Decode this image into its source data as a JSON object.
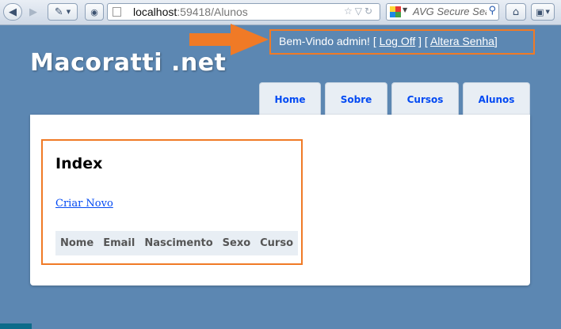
{
  "browser": {
    "url_host": "localhost",
    "url_rest": ":59418/Alunos",
    "search_placeholder": "AVG Secure Sea",
    "icons": [
      "back-arrow-icon",
      "forward-arrow-icon",
      "dropdown-icon",
      "page-icon",
      "star-icon",
      "refresh-icon",
      "search-icon",
      "home-icon",
      "bookmark-icon"
    ]
  },
  "site": {
    "title": "Macoratti .net"
  },
  "login": {
    "welcome": "Bem-Vindo admin!",
    "open_bracket_1": "[",
    "logoff": "Log Off",
    "close_open": "] [",
    "change_password": "Altera Senha",
    "close_bracket": "]"
  },
  "nav": {
    "tabs": [
      {
        "label": "Home"
      },
      {
        "label": "Sobre"
      },
      {
        "label": "Cursos"
      },
      {
        "label": "Alunos"
      }
    ]
  },
  "main": {
    "heading": "Index",
    "create_link": "Criar Novo",
    "columns": [
      "Nome",
      "Email",
      "Nascimento",
      "Sexo",
      "Curso"
    ]
  },
  "colors": {
    "page_bg": "#5c87b2",
    "highlight": "#f07a26",
    "link": "#034af3",
    "tab_bg": "#e8eef4"
  }
}
